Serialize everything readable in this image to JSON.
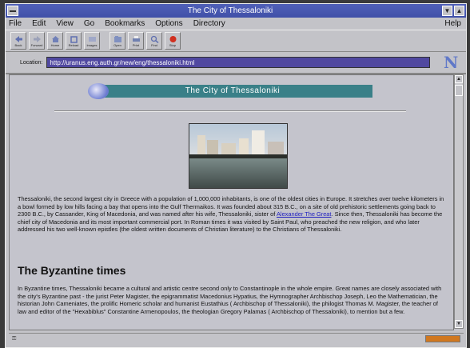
{
  "window": {
    "title": "The City of Thessaloniki"
  },
  "menu": {
    "items": [
      "File",
      "Edit",
      "View",
      "Go",
      "Bookmarks",
      "Options",
      "Directory"
    ],
    "help": "Help"
  },
  "toolbar": {
    "buttons": [
      {
        "label": "Back",
        "icon": "back-arrow-icon"
      },
      {
        "label": "Forward",
        "icon": "forward-arrow-icon"
      },
      {
        "label": "Home",
        "icon": "home-icon"
      },
      {
        "label": "Reload",
        "icon": "reload-icon"
      },
      {
        "label": "Images",
        "icon": "images-icon"
      },
      {
        "label": "Open",
        "icon": "open-icon"
      },
      {
        "label": "Print",
        "icon": "print-icon"
      },
      {
        "label": "Find",
        "icon": "find-icon"
      },
      {
        "label": "Stop",
        "icon": "stop-icon"
      }
    ]
  },
  "location": {
    "label": "Location:",
    "url": "http://uranus.eng.auth.gr/new/eng/thessaloniki.html"
  },
  "page": {
    "banner": "The City of Thessaloniki",
    "intro_before_link": "Thessaloniki, the second largest city in Greece with a population of 1,000,000 inhabitants, is one of the oldest cities in Europe. It stretches over twelve kilometers in a bowl formed by low hills facing a bay that opens into the Gulf Thermaikos. It was founded about 315 B.C., on a site of old prehistoric settlements going back to 2300 B.C., by Cassander, King of Macedonia, and was named after his wife, Thessaloniki, sister of ",
    "intro_link": "Alexander The Great",
    "intro_after_link": ". Since then, Thessaloniki has become the chief city of Macedonia and its most important commercial port. In Roman times it was visited by Saint Paul, who preached the new religion, and who later addressed his two well-known epistles (the oldest written documents of Christian literature) to the Christians of Thessaloniki.",
    "heading": "The Byzantine times",
    "byzantine_text": "In Byzantine times, Thessaloniki became a cultural and artistic centre second only to Constantinople in the whole empire. Great names are closely associated with the city's Byzantine past - the jurist Peter Magister, the epigrammatist Macedonius Hypatius, the Hymnographer Archbischop Joseph, Leo the Mathematician, the historian John Cameniates, the prolific Homeric scholar and humanist Eustathius ( Archbischop of Thessaloniki), the philogist Thomas M. Magister, the teacher of law and editor of the \"Hexabiblus\" Constantine Armenopoulos, the theologian Gregory Palamas ( Archbischop of Thessaloniki), to mention but a few."
  },
  "colors": {
    "titlebar": "#4050a8",
    "location_field": "#5048a0",
    "banner": "#3a8088",
    "link": "#2020c0",
    "progress": "#d07820"
  }
}
